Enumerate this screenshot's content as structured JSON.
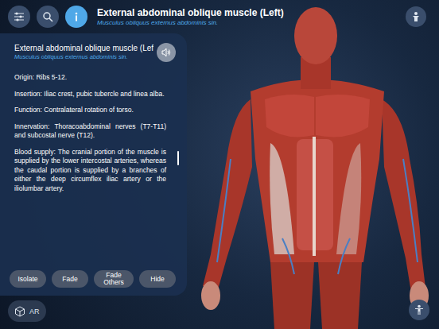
{
  "toolbar": {
    "buttons": [
      {
        "selected": false
      },
      {
        "selected": false
      },
      {
        "selected": true
      }
    ]
  },
  "header": {
    "title": "External abdominal oblique muscle (Left)",
    "subtitle": "Musculus obliquus externus abdominis sin."
  },
  "panel": {
    "title": "External abdominal oblique muscle (Lef",
    "subtitle": "Musculus obliquus externus abdominis sin.",
    "fields": [
      "Origin: Ribs 5-12.",
      "Insertion: Iliac crest, pubic tubercle and linea alba.",
      "Function: Contralateral rotation of torso.",
      "Innervation: Thoracoabdominal nerves (T7-T11) and subcostal nerve (T12).",
      "Blood supply: The cranial portion of the muscle is supplied by the lower intercostal arteries, whereas the caudal portion is supplied by a branches of either the deep circumflex iliac artery or the iliolumbar artery."
    ],
    "actions": [
      "Isolate",
      "Fade",
      "Fade Others",
      "Hide"
    ]
  },
  "ar_button": {
    "label": "AR"
  }
}
